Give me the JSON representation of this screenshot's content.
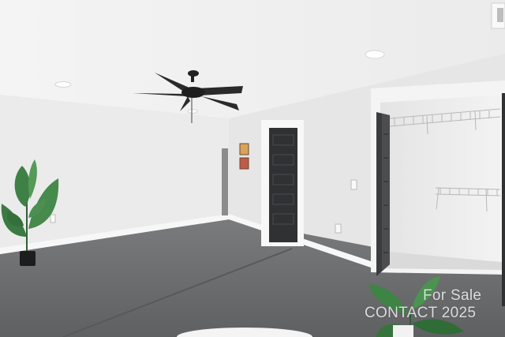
{
  "scene": {
    "subject": "Empty room with ceiling fan, closed dark door and open walk-in closet with wire shelving",
    "colors": {
      "ceiling": "#f1f1f1",
      "left_wall": "#ececec",
      "back_wall": "#e8e8e8",
      "floor": "#6d6e70",
      "door": "#2f3133",
      "plant": "#3f7f45"
    }
  },
  "watermark": {
    "line1": "For Sale",
    "line2": "CONTACT 2025"
  }
}
